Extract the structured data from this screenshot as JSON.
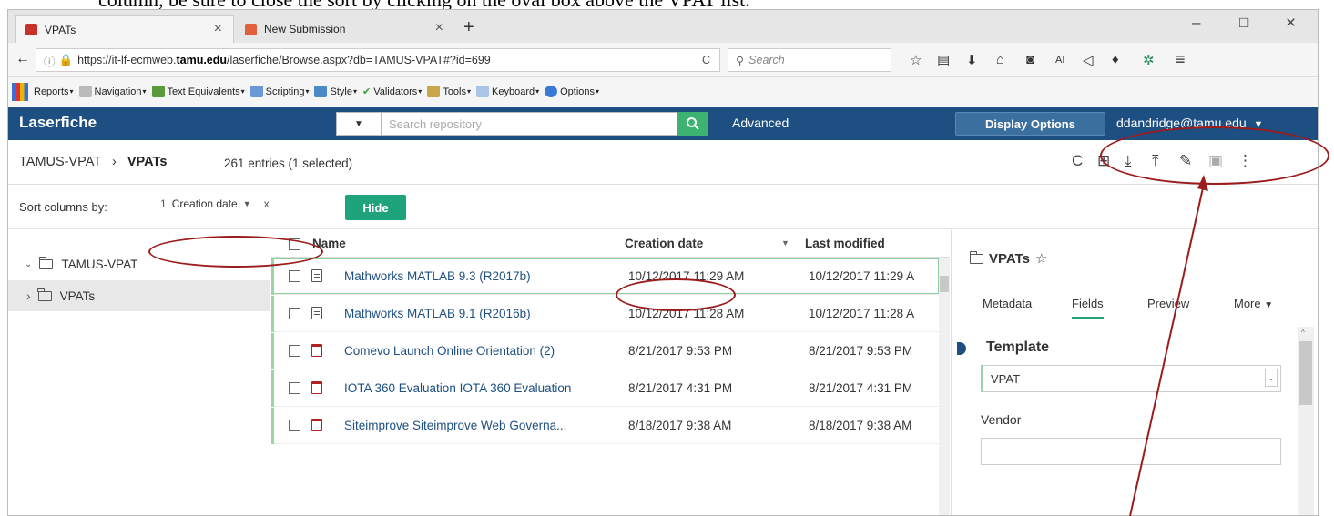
{
  "doc_fragment": "column, be sure to close the sort by clicking on the oval box above the VPAT list.",
  "browser": {
    "tabs": [
      {
        "label": "VPATs",
        "close": "×"
      },
      {
        "label": "New Submission",
        "close": "×"
      }
    ],
    "new_tab": "+",
    "window_controls": {
      "minimize": "–",
      "maximize": "□",
      "close": "×"
    },
    "url_prefix": "https://it-lf-ecmweb.",
    "url_domain": "tamu.edu",
    "url_suffix": "/laserfiche/Browse.aspx?db=TAMUS-VPAT#?id=699",
    "reload": "C",
    "search_placeholder": "Search",
    "toolbar_ai": "AI"
  },
  "wave_toolbar": [
    {
      "label": "Reports",
      "icon": "chart-icon"
    },
    {
      "label": "Navigation",
      "icon": "sitemap-icon"
    },
    {
      "label": "Text Equivalents",
      "icon": "image-icon"
    },
    {
      "label": "Scripting",
      "icon": "script-icon"
    },
    {
      "label": "Style",
      "icon": "style-icon"
    },
    {
      "label": "Validators",
      "icon": "check-icon"
    },
    {
      "label": "Tools",
      "icon": "wrench-icon"
    },
    {
      "label": "Keyboard",
      "icon": "keyboard-icon"
    },
    {
      "label": "Options",
      "icon": "options-icon"
    }
  ],
  "laserfiche": {
    "logo": "Laserfiche",
    "search_placeholder": "Search repository",
    "advanced": "Advanced",
    "display_options": "Display Options",
    "user": "ddandridge@tamu.edu"
  },
  "breadcrumb": {
    "root": "TAMUS-VPAT",
    "separator": "›",
    "current": "VPATs",
    "entries": "261 entries (1 selected)"
  },
  "sort": {
    "label": "Sort columns by:",
    "chip_number": "1",
    "chip_label": "Creation date",
    "chip_remove": "x",
    "hide_button": "Hide"
  },
  "tree": {
    "root": "TAMUS-VPAT",
    "child": "VPATs"
  },
  "list": {
    "columns": [
      "Name",
      "Creation date",
      "Last modified"
    ],
    "rows": [
      {
        "name": "Mathworks MATLAB 9.3 (R2017b)",
        "created": "10/12/2017 11:29 AM",
        "modified": "10/12/2017 11:29 A",
        "type": "doc"
      },
      {
        "name": "Mathworks MATLAB 9.1 (R2016b)",
        "created": "10/12/2017 11:28 AM",
        "modified": "10/12/2017 11:28 A",
        "type": "doc"
      },
      {
        "name": "Comevo Launch Online Orientation (2)",
        "created": "8/21/2017 9:53 PM",
        "modified": "8/21/2017 9:53 PM",
        "type": "pdf"
      },
      {
        "name": "IOTA 360 Evaluation IOTA 360 Evaluation",
        "created": "8/21/2017 4:31 PM",
        "modified": "8/21/2017 4:31 PM",
        "type": "pdf"
      },
      {
        "name": "Siteimprove Siteimprove Web Governa...",
        "created": "8/18/2017 9:38 AM",
        "modified": "8/18/2017 9:38 AM",
        "type": "pdf"
      }
    ]
  },
  "details": {
    "title": "VPATs",
    "star": "☆",
    "tabs": [
      "Metadata",
      "Fields",
      "Preview",
      "More"
    ],
    "section": "Template",
    "template_value": "VPAT",
    "vendor_label": "Vendor"
  },
  "colors": {
    "header_blue": "#1e4f82",
    "hide_green": "#1fa37a",
    "annotation_red": "#9b1c1c"
  }
}
